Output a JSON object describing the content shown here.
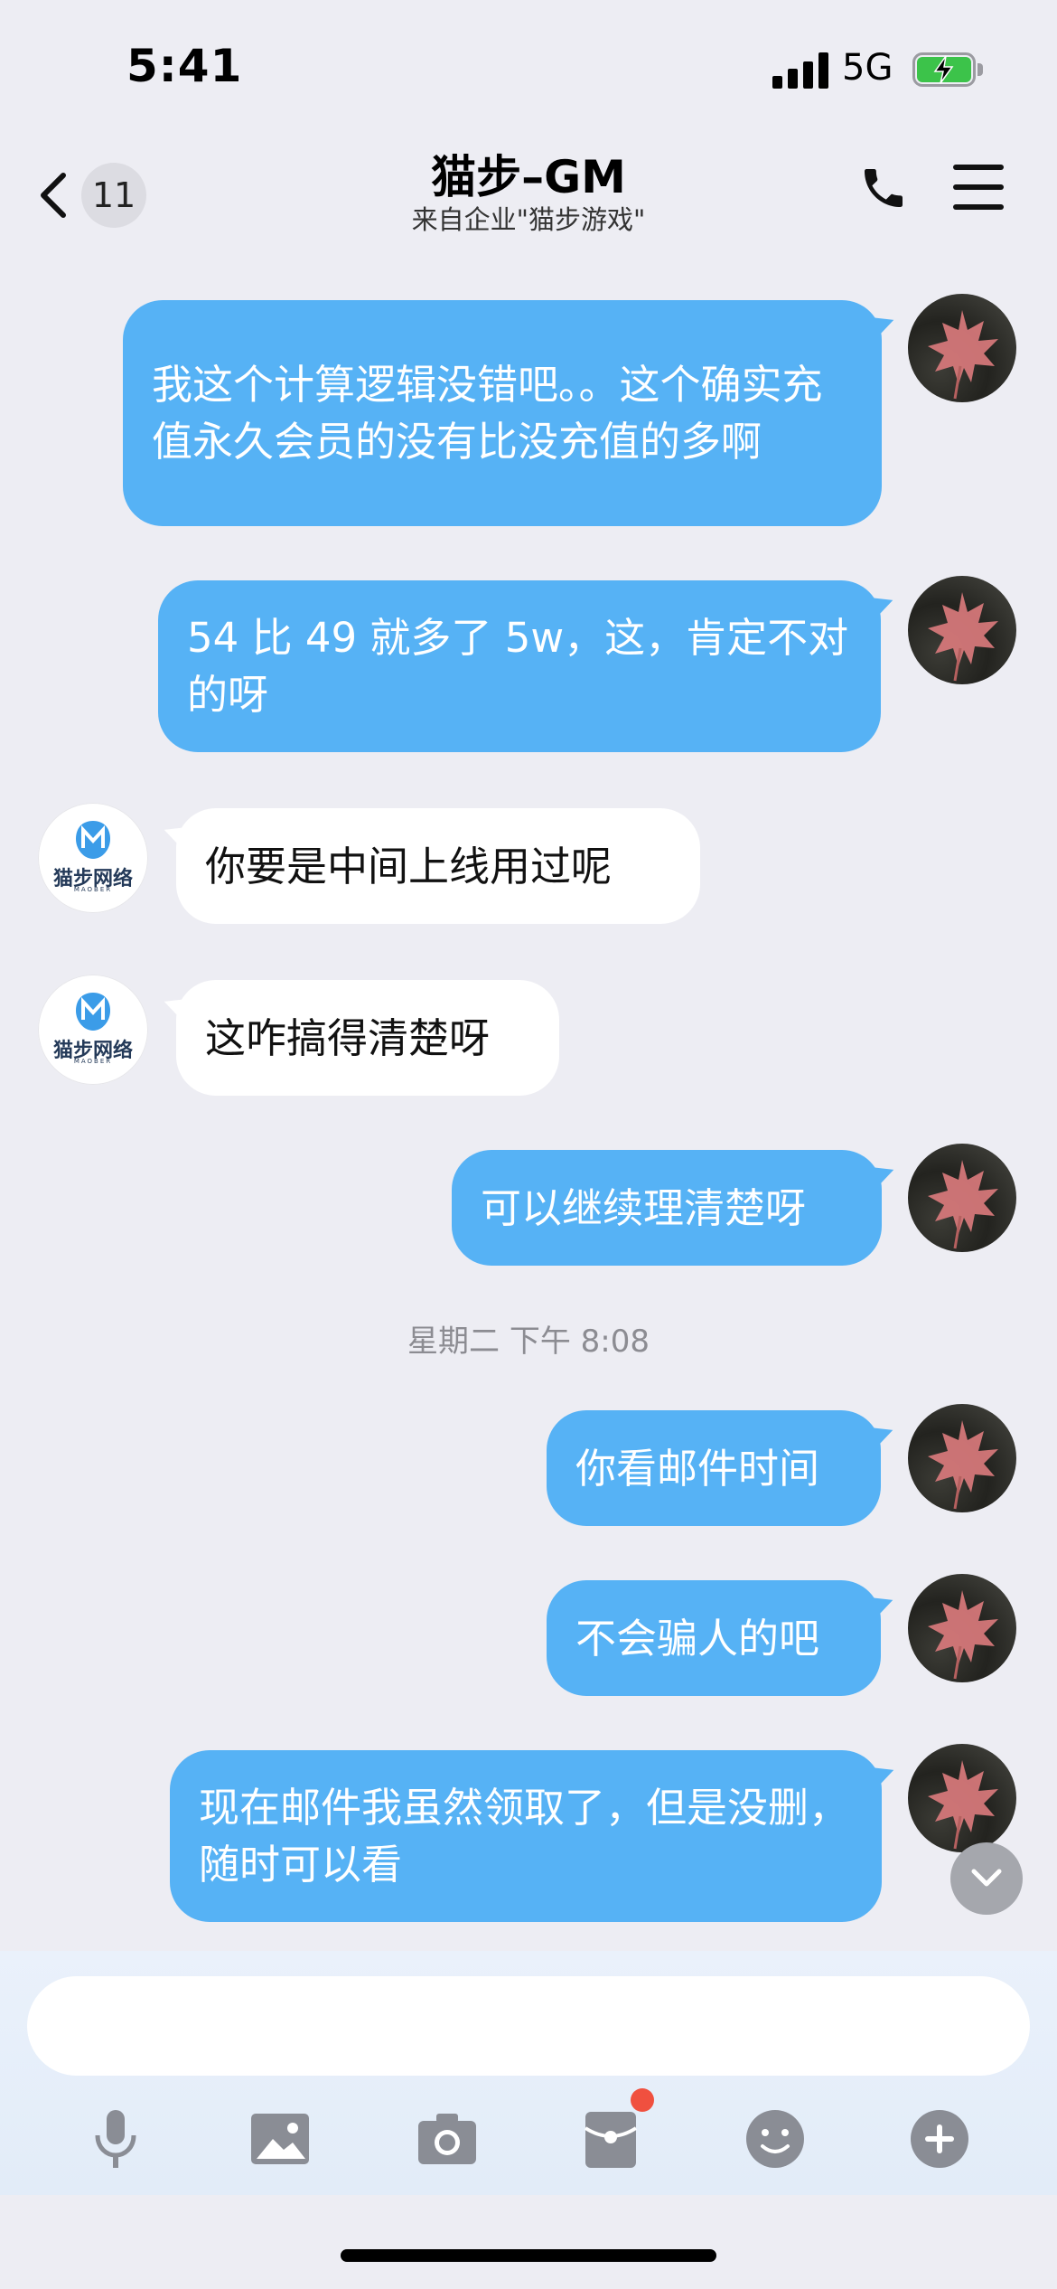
{
  "status": {
    "time": "5:41",
    "network": "5G"
  },
  "nav": {
    "back_badge": "11",
    "title": "猫步–GM",
    "subtitle": "来自企业\"猫步游戏\""
  },
  "messages": [
    {
      "side": "out",
      "text": "我这个计算逻辑没错吧。。这个确实充值永久会员的没有比没充值的多啊"
    },
    {
      "side": "out",
      "text": "54 比 49 就多了 5w，这，肯定不对的呀"
    },
    {
      "side": "in",
      "text": "你要是中间上线用过呢"
    },
    {
      "side": "in",
      "text": "这咋搞得清楚呀"
    },
    {
      "side": "out",
      "text": "可以继续理清楚呀"
    },
    {
      "side": "out",
      "text": "你看邮件时间"
    },
    {
      "side": "out",
      "text": "不会骗人的吧"
    },
    {
      "side": "out",
      "text": "现在邮件我虽然领取了，但是没删，随时可以看"
    }
  ],
  "timestamp": "星期二 下午 8:08",
  "contact_avatar": {
    "name": "猫步网络",
    "sub": "MAOBER"
  },
  "input": {
    "value": ""
  },
  "toolbar": [
    "microphone-icon",
    "image-icon",
    "camera-icon",
    "red-packet-icon",
    "emoji-icon",
    "plus-icon"
  ],
  "colors": {
    "outgoing_bubble": "#56b2f5",
    "incoming_bubble": "#ffffff",
    "background": "#ededf3",
    "badge_dot": "#f0503f"
  }
}
